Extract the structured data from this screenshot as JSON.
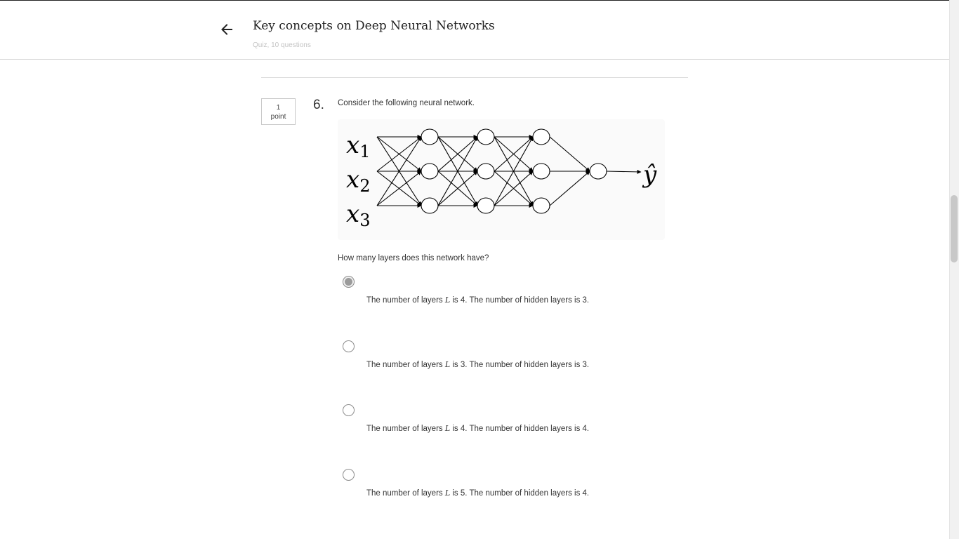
{
  "header": {
    "title": "Key concepts on Deep Neural Networks",
    "subtitle": "Quiz, 10 questions"
  },
  "question": {
    "points_value": "1",
    "points_label": "point",
    "number": "6.",
    "prompt": "Consider the following neural network.",
    "subprompt": "How many layers does this network have?",
    "figure": {
      "inputs": [
        "x1",
        "x2",
        "x3"
      ],
      "output": "ŷ"
    },
    "options": [
      {
        "pre": "The number of layers ",
        "var": "L",
        "post": " is 4. The number of hidden layers is 3.",
        "selected": true
      },
      {
        "pre": "The number of layers ",
        "var": "L",
        "post": " is 3. The number of hidden layers is 3.",
        "selected": false
      },
      {
        "pre": "The number of layers ",
        "var": "L",
        "post": " is 4. The number of hidden layers is 4.",
        "selected": false
      },
      {
        "pre": "The number of layers ",
        "var": "L",
        "post": " is 5. The number of hidden layers is 4.",
        "selected": false
      }
    ]
  }
}
